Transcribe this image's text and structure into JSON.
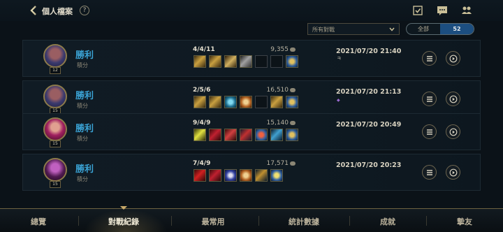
{
  "header": {
    "title": "個人檔案",
    "help_glyph": "?"
  },
  "filter": {
    "selected": "所有對戰"
  },
  "toggle": {
    "all_label": "全部",
    "count_label": "52"
  },
  "matches": [
    {
      "result": "勝利",
      "mode": "積分",
      "level": "12",
      "kda": "4/4/11",
      "gold": "9,355",
      "date": "2021/07/20 21:40",
      "badge": "ㅋ"
    },
    {
      "result": "勝利",
      "mode": "積分",
      "level": "15",
      "kda": "2/5/6",
      "gold": "16,510",
      "date": "2021/07/20 21:13",
      "badge": "◆"
    },
    {
      "result": "勝利",
      "mode": "積分",
      "level": "15",
      "kda": "9/4/9",
      "gold": "15,140",
      "date": "2021/07/20 20:49",
      "badge": ""
    },
    {
      "result": "勝利",
      "mode": "積分",
      "level": "15",
      "kda": "7/4/9",
      "gold": "17,571",
      "date": "2021/07/20 20:23",
      "badge": ""
    }
  ],
  "tabs": [
    "總覽",
    "對戰紀錄",
    "最常用",
    "統計數據",
    "成就",
    "摯友"
  ],
  "colors": {
    "accent": "#3aa2d4",
    "gold_frame": "#8c7a4a",
    "active_toggle": "#1c4e80"
  }
}
